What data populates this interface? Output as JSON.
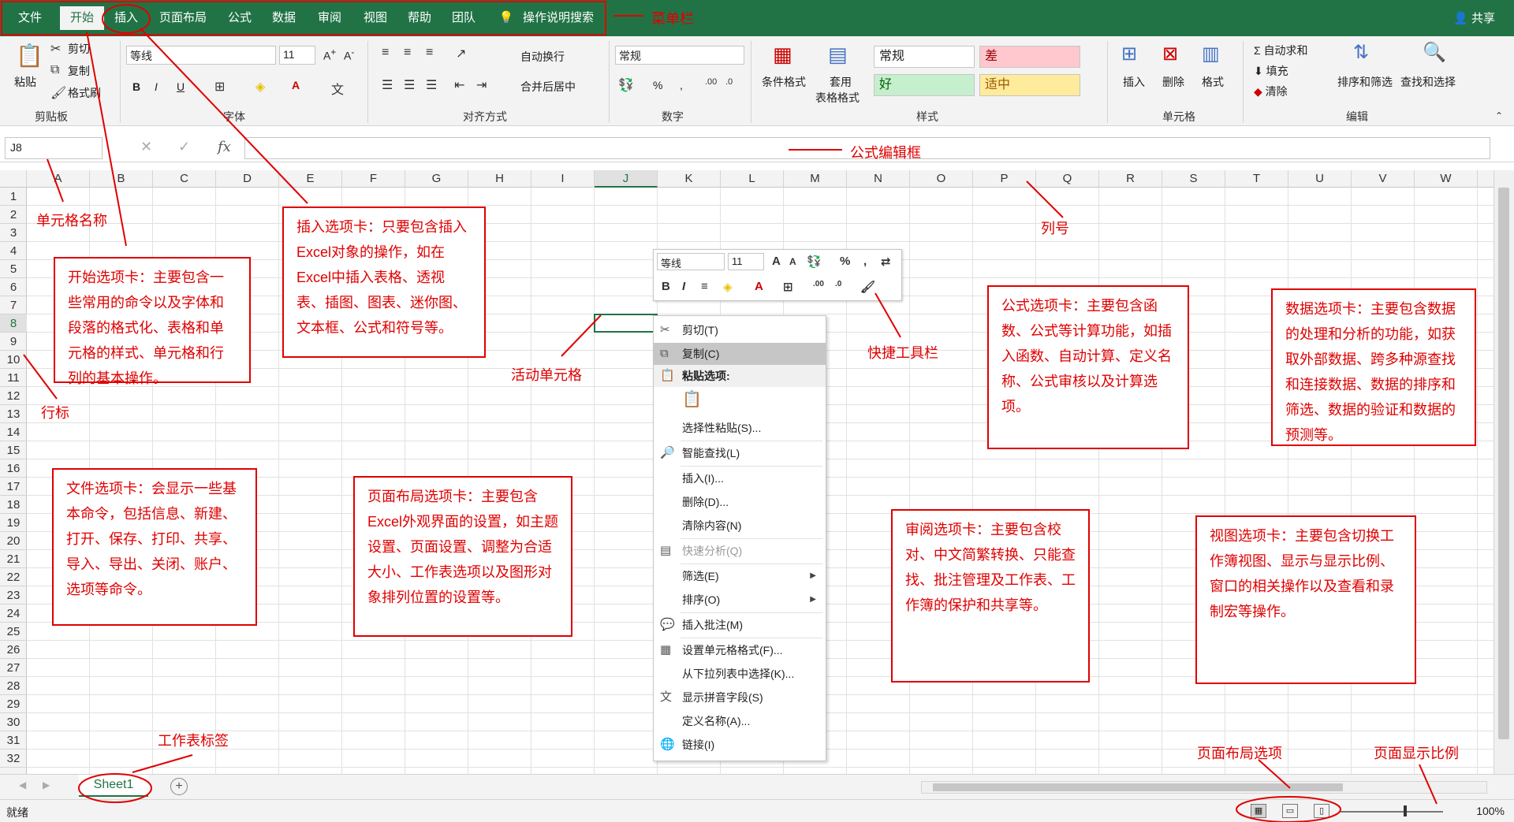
{
  "menu": {
    "tabs": [
      "文件",
      "开始",
      "插入",
      "页面布局",
      "公式",
      "数据",
      "审阅",
      "视图",
      "帮助",
      "团队"
    ],
    "search_label": "操作说明搜索",
    "share_label": "共享"
  },
  "ribbon": {
    "clipboard": {
      "paste": "粘贴",
      "cut": "剪切",
      "copy": "复制",
      "format_painter": "格式刷",
      "label": "剪贴板"
    },
    "font": {
      "name": "等线",
      "size": "11",
      "bold": "B",
      "italic": "I",
      "underline": "U",
      "label": "字体"
    },
    "alignment": {
      "wrap": "自动换行",
      "merge": "合并后居中",
      "label": "对齐方式"
    },
    "number": {
      "format": "常规",
      "percent": "%",
      "comma": ",",
      "label": "数字"
    },
    "styles": {
      "conditional": "条件格式",
      "table_format": "套用",
      "table_format2": "表格格式",
      "normal": "常规",
      "bad": "差",
      "good": "好",
      "neutral": "适中",
      "label": "样式"
    },
    "cells": {
      "insert": "插入",
      "delete": "删除",
      "format": "格式",
      "label": "单元格"
    },
    "editing": {
      "autosum": "自动求和",
      "fill": "填充",
      "clear": "清除",
      "sort": "排序和筛选",
      "find": "查找和选择",
      "label": "编辑"
    }
  },
  "formula_bar": {
    "name_box": "J8",
    "fx": "fx"
  },
  "grid": {
    "columns": [
      "A",
      "B",
      "C",
      "D",
      "E",
      "F",
      "G",
      "H",
      "I",
      "J",
      "K",
      "L",
      "M",
      "N",
      "O",
      "P",
      "Q",
      "R",
      "S",
      "T",
      "U",
      "V",
      "W"
    ],
    "rows": [
      "1",
      "2",
      "3",
      "4",
      "5",
      "6",
      "7",
      "8",
      "9",
      "10",
      "11",
      "12",
      "13",
      "14",
      "15",
      "16",
      "17",
      "18",
      "19",
      "20",
      "21",
      "22",
      "23",
      "24",
      "25",
      "26",
      "27",
      "28",
      "29",
      "30",
      "31",
      "32"
    ],
    "active_col": "J",
    "active_row": "8"
  },
  "sheet_tabs": {
    "sheet1": "Sheet1"
  },
  "status": {
    "ready": "就绪",
    "zoom": "100%"
  },
  "mini_toolbar": {
    "font": "等线",
    "size": "11"
  },
  "context_menu": {
    "cut": "剪切(T)",
    "copy": "复制(C)",
    "paste_options": "粘贴选项:",
    "paste_special": "选择性粘贴(S)...",
    "smart_lookup": "智能查找(L)",
    "insert": "插入(I)...",
    "delete": "删除(D)...",
    "clear": "清除内容(N)",
    "quick_analysis": "快速分析(Q)",
    "filter": "筛选(E)",
    "sort": "排序(O)",
    "insert_comment": "插入批注(M)",
    "format_cells": "设置单元格格式(F)...",
    "pick_list": "从下拉列表中选择(K)...",
    "phonetic": "显示拼音字段(S)",
    "define_name": "定义名称(A)...",
    "link": "链接(I)"
  },
  "annotations": {
    "menubar": "菜单栏",
    "formula_bar": "公式编辑框",
    "cell_name": "单元格名称",
    "column": "列号",
    "row": "行标",
    "active_cell": "活动单元格",
    "quick_toolbar": "快捷工具栏",
    "sheet_tab": "工作表标签",
    "page_layout_option": "页面布局选项",
    "zoom": "页面显示比例",
    "home_tab": "开始选项卡：主要包含一些常用的命令以及字体和段落的格式化、表格和单元格的样式、单元格和行列的基本操作。",
    "insert_tab": "插入选项卡：只要包含插入Excel对象的操作，如在Excel中插入表格、透视表、插图、图表、迷你图、文本框、公式和符号等。",
    "file_tab": "文件选项卡：会显示一些基本命令，包括信息、新建、打开、保存、打印、共享、导入、导出、关闭、账户、选项等命令。",
    "page_layout_tab": "页面布局选项卡：主要包含Excel外观界面的设置，如主题设置、页面设置、调整为合适大小、工作表选项以及图形对象排列位置的设置等。",
    "formula_tab": "公式选项卡：主要包含函数、公式等计算功能，如插入函数、自动计算、定义名称、公式审核以及计算选项。",
    "data_tab": "数据选项卡：主要包含数据的处理和分析的功能，如获取外部数据、跨多种源查找和连接数据、数据的排序和筛选、数据的验证和数据的预测等。",
    "review_tab": "审阅选项卡：主要包含校对、中文简繁转换、只能查找、批注管理及工作表、工作簿的保护和共享等。",
    "view_tab": "视图选项卡：主要包含切换工作簿视图、显示与显示比例、窗口的相关操作以及查看和录制宏等操作。"
  },
  "colors": {
    "excel_green": "#217346",
    "annotation_red": "#e00000"
  }
}
